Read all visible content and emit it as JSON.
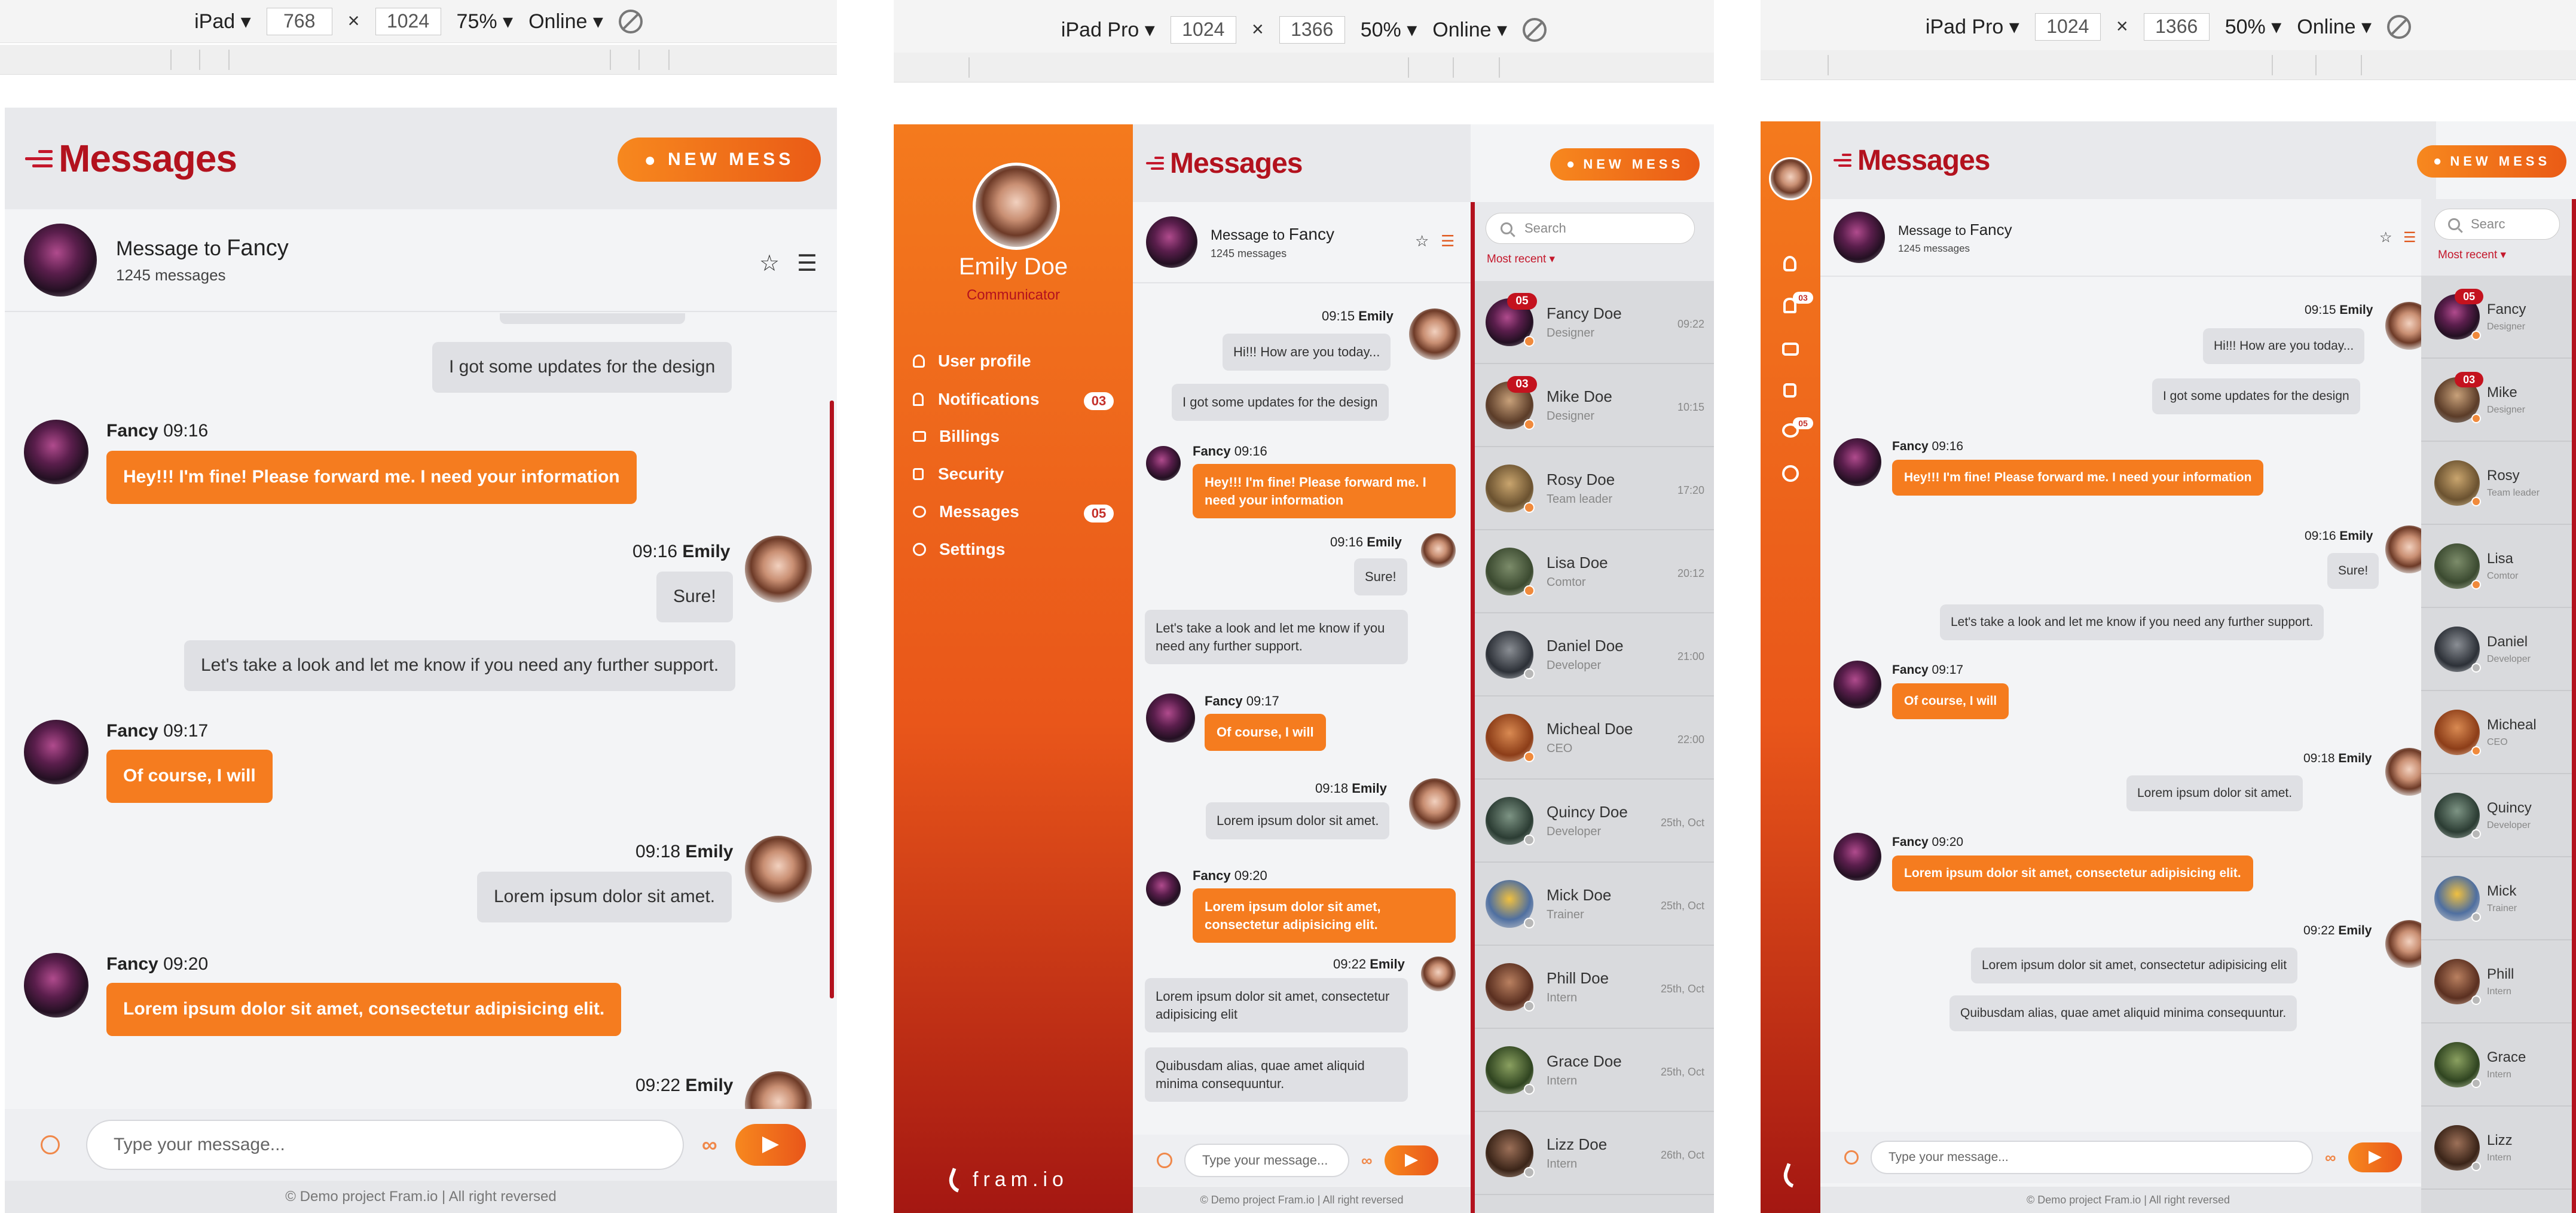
{
  "devtools": [
    {
      "device": "iPad",
      "width": "768",
      "height": "1024",
      "zoom": "75%",
      "network": "Online"
    },
    {
      "device": "iPad Pro",
      "width": "1024",
      "height": "1366",
      "zoom": "50%",
      "network": "Online"
    },
    {
      "device": "iPad Pro",
      "width": "1024",
      "height": "1366",
      "zoom": "50%",
      "network": "Online"
    }
  ],
  "app": {
    "title": "Messages",
    "new_button": "NEW MESS",
    "chat_with_prefix": "Message to ",
    "chat_with_name": "Fancy",
    "message_count": "1245 messages",
    "composer_placeholder": "Type your message...",
    "footer": "© Demo project Fram.io | All right reversed",
    "search_placeholder": "Search",
    "search_placeholder_short": "Searc",
    "sort_label": "Most recent",
    "user": {
      "name": "Emily Doe",
      "role": "Communicator"
    },
    "logo_text": "fram.io"
  },
  "menu": [
    {
      "label": "User profile",
      "badge": ""
    },
    {
      "label": "Notifications",
      "badge": "03"
    },
    {
      "label": "Billings",
      "badge": ""
    },
    {
      "label": "Security",
      "badge": ""
    },
    {
      "label": "Messages",
      "badge": "05"
    },
    {
      "label": "Settings",
      "badge": ""
    }
  ],
  "messages": [
    {
      "from": "Emily",
      "time": "09:15",
      "dir": "out",
      "text": "Hi!!! How are you today..."
    },
    {
      "from": "Emily",
      "time": "",
      "dir": "out",
      "text": "I got some updates for the design"
    },
    {
      "from": "Fancy",
      "time": "09:16",
      "dir": "in",
      "text": "Hey!!! I'm fine! Please forward me. I need your information"
    },
    {
      "from": "Emily",
      "time": "09:16",
      "dir": "out",
      "text": "Sure!"
    },
    {
      "from": "Emily",
      "time": "",
      "dir": "out",
      "text": "Let's take a look and let me know if you need any further support."
    },
    {
      "from": "Fancy",
      "time": "09:17",
      "dir": "in",
      "text": "Of course, I will"
    },
    {
      "from": "Emily",
      "time": "09:18",
      "dir": "out",
      "text": "Lorem ipsum dolor sit amet."
    },
    {
      "from": "Fancy",
      "time": "09:20",
      "dir": "in",
      "text": "Lorem ipsum dolor sit amet, consectetur adipisicing elit."
    },
    {
      "from": "Emily",
      "time": "09:22",
      "dir": "out",
      "text": "Lorem ipsum dolor sit amet, consectetur adipisicing elit"
    },
    {
      "from": "Emily",
      "time": "",
      "dir": "out",
      "text": "Quibusdam alias, quae amet aliquid minima consequuntur."
    }
  ],
  "contacts": [
    {
      "name": "Fancy Doe",
      "short": "Fancy",
      "role": "Designer",
      "time": "09:22",
      "badge": "05",
      "status": "online"
    },
    {
      "name": "Mike Doe",
      "short": "Mike",
      "role": "Designer",
      "time": "10:15",
      "badge": "03",
      "status": "online"
    },
    {
      "name": "Rosy Doe",
      "short": "Rosy",
      "role": "Team leader",
      "time": "17:20",
      "badge": "",
      "status": "online"
    },
    {
      "name": "Lisa Doe",
      "short": "Lisa",
      "role": "Comtor",
      "time": "20:12",
      "badge": "",
      "status": "online"
    },
    {
      "name": "Daniel Doe",
      "short": "Daniel",
      "role": "Developer",
      "time": "21:00",
      "badge": "",
      "status": "away"
    },
    {
      "name": "Micheal Doe",
      "short": "Micheal",
      "role": "CEO",
      "time": "22:00",
      "badge": "",
      "status": "online"
    },
    {
      "name": "Quincy Doe",
      "short": "Quincy",
      "role": "Developer",
      "time": "25th, Oct",
      "badge": "",
      "status": "away"
    },
    {
      "name": "Mick Doe",
      "short": "Mick",
      "role": "Trainer",
      "time": "25th, Oct",
      "badge": "",
      "status": "away"
    },
    {
      "name": "Phill Doe",
      "short": "Phill",
      "role": "Intern",
      "time": "25th, Oct",
      "badge": "",
      "status": "away"
    },
    {
      "name": "Grace Doe",
      "short": "Grace",
      "role": "Intern",
      "time": "25th, Oct",
      "badge": "",
      "status": "away"
    },
    {
      "name": "Lizz Doe",
      "short": "Lizz",
      "role": "Intern",
      "time": "26th, Oct",
      "badge": "",
      "status": "away"
    }
  ],
  "colors": {
    "accent": "#f57c1f",
    "brand_red": "#b3121e",
    "bubble_out": "#dfe0e4"
  }
}
